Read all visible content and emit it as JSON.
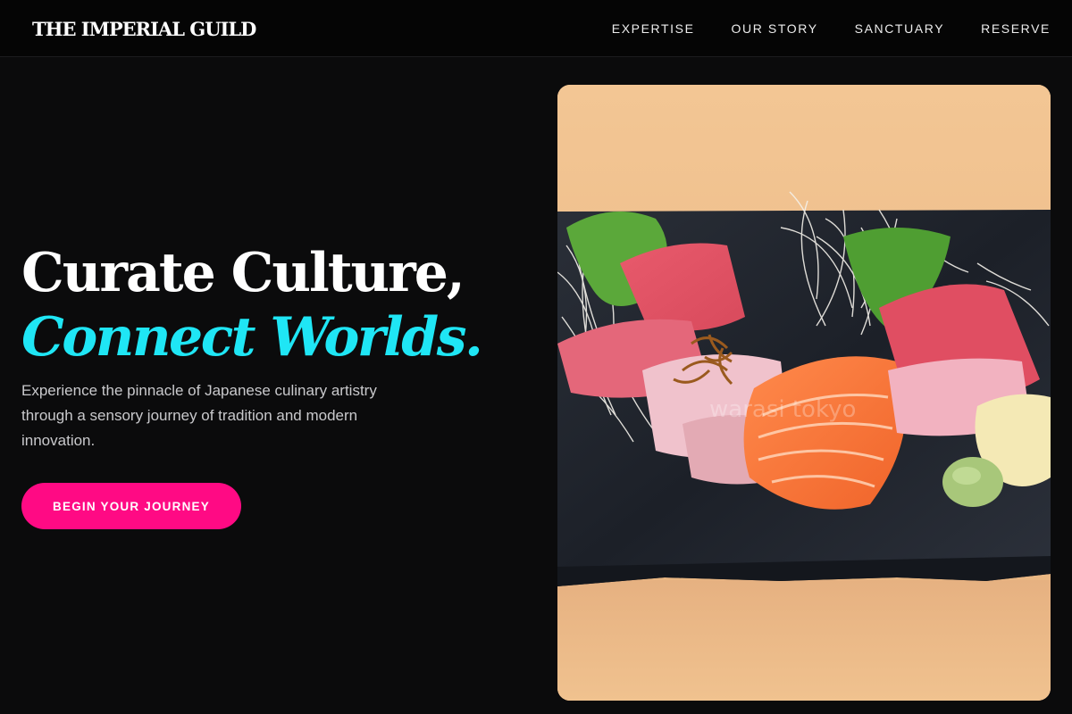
{
  "brand": {
    "name": "THE IMPERIAL GUILD"
  },
  "nav": {
    "items": [
      {
        "label": "EXPERTISE"
      },
      {
        "label": "OUR STORY"
      },
      {
        "label": "SANCTUARY"
      },
      {
        "label": "RESERVE"
      }
    ]
  },
  "hero": {
    "headline_line1": "Curate Culture,",
    "headline_line2": "Connect Worlds.",
    "subtext": "Experience the pinnacle of Japanese culinary artistry through a sensory journey of tradition and modern innovation.",
    "cta_label": "BEGIN YOUR JOURNEY",
    "image": {
      "subject": "sashimi-platter-on-slate",
      "watermark": "warasi tokyo"
    }
  },
  "colors": {
    "background": "#0b0b0c",
    "accent_cyan": "#1fe6f5",
    "cta_pink": "#ff0a84",
    "text_white": "#ffffff"
  }
}
